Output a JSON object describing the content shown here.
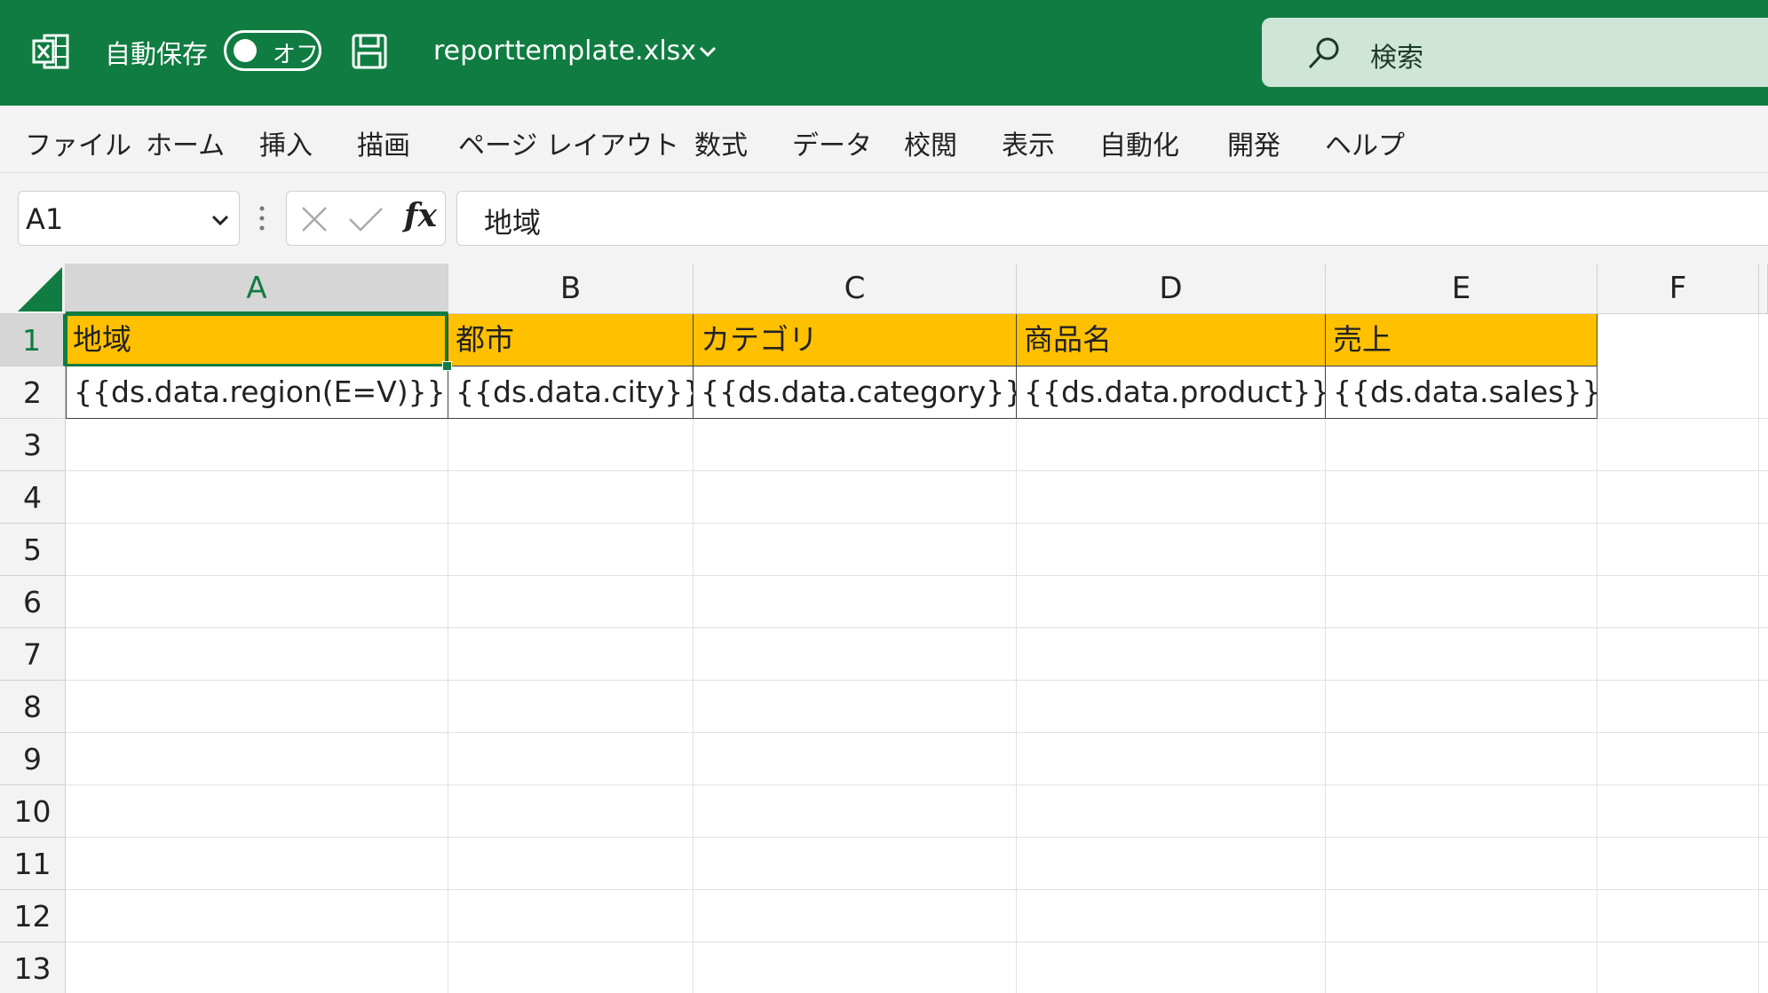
{
  "titlebar": {
    "autosave_label": "自動保存",
    "autosave_state": "オフ",
    "filename": "reporttemplate.xlsx",
    "search_placeholder": "検索",
    "brand_color": "#107c41"
  },
  "ribbon": {
    "tabs": [
      "ファイル",
      "ホーム",
      "挿入",
      "描画",
      "ページ レイアウト",
      "数式",
      "データ",
      "校閲",
      "表示",
      "自動化",
      "開発",
      "ヘルプ"
    ]
  },
  "formula_bar": {
    "name_box": "A1",
    "content": "地域",
    "fx_label": "fx"
  },
  "sheet": {
    "columns": [
      "A",
      "B",
      "C",
      "D",
      "E",
      "F"
    ],
    "rows": [
      "1",
      "2",
      "3",
      "4",
      "5",
      "6",
      "7",
      "8",
      "9",
      "10",
      "11",
      "12",
      "13"
    ],
    "selected_cell": "A1",
    "header_fill": "#ffc000",
    "row1": [
      "地域",
      "都市",
      "カテゴリ",
      "商品名",
      "売上"
    ],
    "row2": [
      "{{ds.data.region(E=V)}}",
      "{{ds.data.city}}",
      "{{ds.data.category}}",
      "{{ds.data.product}}",
      "{{ds.data.sales}}"
    ]
  }
}
